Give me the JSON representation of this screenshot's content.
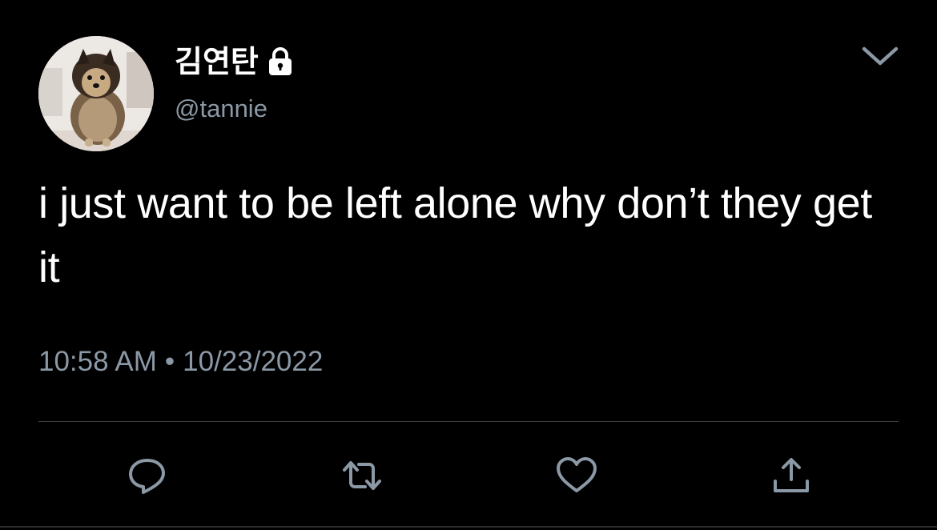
{
  "tweet": {
    "display_name": "김연탄",
    "handle": "@tannie",
    "text": "i just want to be left alone why don’t they get it",
    "time": "10:58 AM",
    "separator": "•",
    "date": "10/23/2022",
    "protected": true
  },
  "icons": {
    "lock": "lock-icon",
    "caret": "chevron-down-icon",
    "reply": "reply-icon",
    "retweet": "retweet-icon",
    "like": "heart-icon",
    "share": "share-icon"
  },
  "colors": {
    "background": "#000000",
    "primary_text": "#ffffff",
    "secondary_text": "#8b98a5",
    "divider": "#3a3f44"
  }
}
